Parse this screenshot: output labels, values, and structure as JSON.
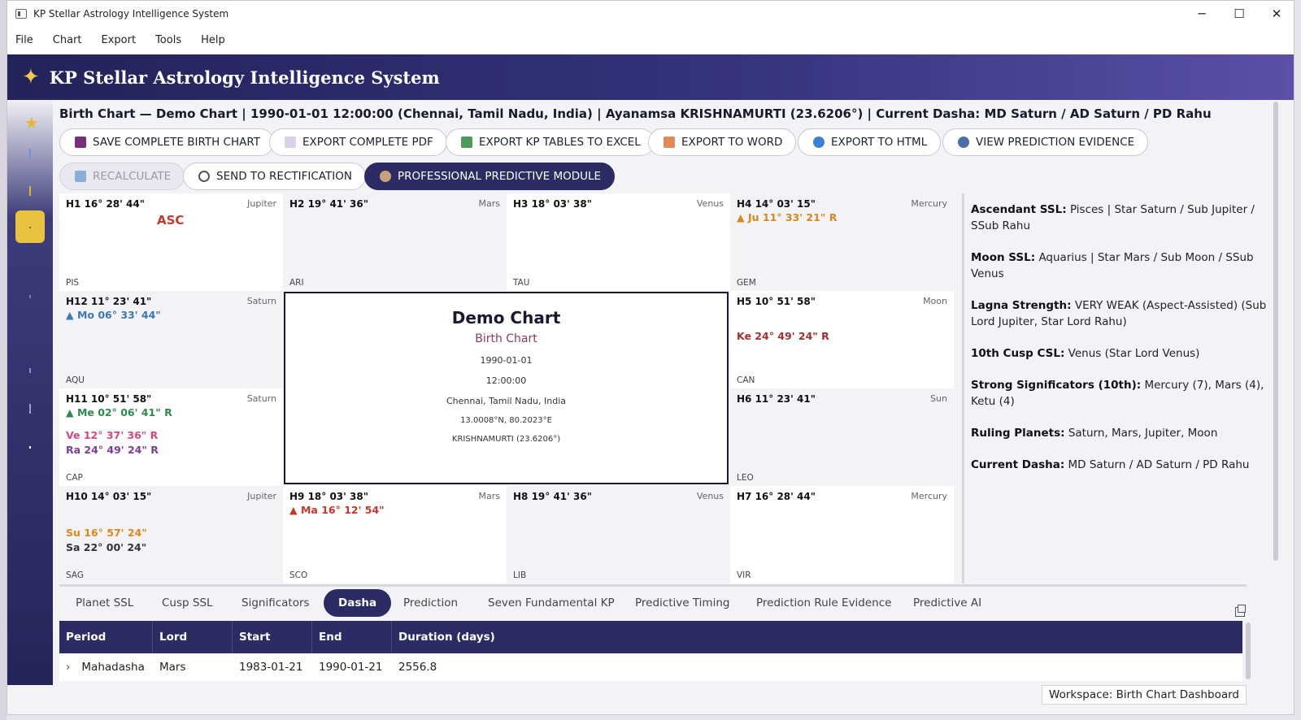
{
  "window": {
    "title": "KP Stellar Astrology Intelligence System",
    "controls": [
      "─",
      "☐",
      "✕"
    ]
  },
  "menu": [
    "File",
    "Chart",
    "Export",
    "Tools",
    "Help"
  ],
  "banner": {
    "icon": "star-icon",
    "title": "KP Stellar Astrology Intelligence System"
  },
  "headline": "Birth Chart — Demo Chart  |  1990-01-01 12:00:00 (Chennai, Tamil Nadu, India)  |  Ayanamsa KRISHNAMURTI (23.6206°)  |  Current Dasha: MD Saturn / AD Saturn / PD Rahu",
  "buttons": {
    "save": "SAVE COMPLETE BIRTH CHART",
    "pdf": "EXPORT COMPLETE PDF",
    "excel": "EXPORT KP TABLES TO EXCEL",
    "word": "EXPORT TO WORD",
    "html": "EXPORT TO HTML",
    "evidence": "VIEW PREDICTION EVIDENCE",
    "recalc": "RECALCULATE",
    "rectify": "SEND TO RECTIFICATION",
    "predictive": "PROFESSIONAL PREDICTIVE MODULE"
  },
  "houses": [
    {
      "id": "h1",
      "head": "H1  16° 28' 44\"",
      "lord": "Jupiter",
      "sign": "PIS",
      "asc": "ASC",
      "planets": []
    },
    {
      "id": "h2",
      "head": "H2  19° 41' 36\"",
      "lord": "Mars",
      "sign": "ARI",
      "planets": []
    },
    {
      "id": "h3",
      "head": "H3  18° 03' 38\"",
      "lord": "Venus",
      "sign": "TAU",
      "planets": []
    },
    {
      "id": "h4",
      "head": "H4  14° 03' 15\"",
      "lord": "Mercury",
      "sign": "GEM",
      "planets": [
        {
          "text": "▲ Ju 11° 33' 21\" R",
          "color": "#d4881f"
        }
      ]
    },
    {
      "id": "h12",
      "head": "H12  11° 23' 41\"",
      "lord": "Saturn",
      "sign": "AQU",
      "planets": [
        {
          "text": "▲ Mo 06° 33' 44\"",
          "color": "#3b78b5"
        }
      ]
    },
    {
      "id": "h5",
      "head": "H5  10° 51' 58\"",
      "lord": "Moon",
      "sign": "CAN",
      "planets": [
        {
          "text": "Ke 24° 49' 24\" R",
          "color": "#a0302a"
        }
      ]
    },
    {
      "id": "h11",
      "head": "H11  10° 51' 58\"",
      "lord": "Saturn",
      "sign": "CAP",
      "planets": [
        {
          "text": "▲ Me 02° 06' 41\" R",
          "color": "#2e8b4e"
        },
        {
          "text": "Ve 12° 37' 36\" R",
          "color": "#d6477f"
        },
        {
          "text": "Ra 24° 49' 24\" R",
          "color": "#7d3c98"
        }
      ]
    },
    {
      "id": "h6",
      "head": "H6  11° 23' 41\"",
      "lord": "Sun",
      "sign": "LEO",
      "planets": []
    },
    {
      "id": "h10",
      "head": "H10  14° 03' 15\"",
      "lord": "Jupiter",
      "sign": "SAG",
      "planets": [
        {
          "text": "Su 16° 57' 24\"",
          "color": "#e0861a"
        },
        {
          "text": "Sa 22° 00' 24\"",
          "color": "#333333"
        }
      ]
    },
    {
      "id": "h9",
      "head": "H9  18° 03' 38\"",
      "lord": "Mars",
      "sign": "SCO",
      "planets": [
        {
          "text": "▲ Ma 16° 12' 54\"",
          "color": "#c0392b"
        }
      ]
    },
    {
      "id": "h8",
      "head": "H8  19° 41' 36\"",
      "lord": "Venus",
      "sign": "LIB",
      "planets": []
    },
    {
      "id": "h7",
      "head": "H7  16° 28' 44\"",
      "lord": "Mercury",
      "sign": "VIR",
      "planets": []
    }
  ],
  "center": {
    "title": "Demo Chart",
    "subtitle": "Birth Chart",
    "date": "1990-01-01",
    "time": "12:00:00",
    "place": "Chennai, Tamil Nadu, India",
    "coords": "13.0008°N, 80.2023°E",
    "ayanamsa": "KRISHNAMURTI (23.6206°)"
  },
  "summary": [
    {
      "key": "Ascendant SSL:",
      "value": "Pisces | Star Saturn / Sub Jupiter / SSub Rahu"
    },
    {
      "key": "Moon SSL:",
      "value": "Aquarius | Star Mars / Sub Moon / SSub Venus"
    },
    {
      "key": "Lagna Strength:",
      "value": "VERY WEAK (Aspect-Assisted) (Sub Lord Jupiter, Star Lord Rahu)"
    },
    {
      "key": "10th Cusp CSL:",
      "value": "Venus (Star Lord Venus)"
    },
    {
      "key": "Strong Significators (10th):",
      "value": "Mercury (7), Mars (4), Ketu (4)"
    },
    {
      "key": "Ruling Planets:",
      "value": "Saturn, Mars, Jupiter, Moon"
    },
    {
      "key": "Current Dasha:",
      "value": "MD Saturn / AD Saturn / PD Rahu"
    }
  ],
  "tabs": [
    "Planet SSL",
    "Cusp SSL",
    "Significators",
    "Dasha",
    "Prediction",
    "Seven Fundamental KP",
    "Predictive Timing",
    "Prediction Rule Evidence",
    "Predictive AI"
  ],
  "active_tab": "Dasha",
  "table": {
    "columns": [
      "Period",
      "Lord",
      "Start",
      "End",
      "Duration (days)"
    ],
    "rows": [
      {
        "expander": "›",
        "period": "Mahadasha",
        "lord": "Mars",
        "start": "1983-01-21",
        "end": "1990-01-21",
        "duration": "2556.8"
      }
    ]
  },
  "status": "Workspace: Birth Chart Dashboard",
  "colors": {
    "accent": "#2d2b63",
    "brand_gold": "#e9c23e"
  }
}
